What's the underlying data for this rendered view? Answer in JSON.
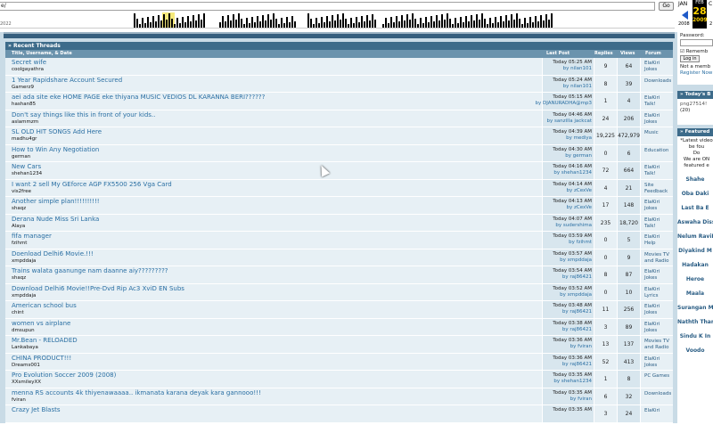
{
  "topbar": {
    "url_fragment": "e/",
    "go_label": "Go",
    "year_left": "2022"
  },
  "calendar": {
    "prev_month": "JAN",
    "month": "FEB",
    "day": "28",
    "year": "2009",
    "next_prefix": "C",
    "prev_year": "2008",
    "next_year_prefix": "2"
  },
  "threads": {
    "header": "» Recent Threads",
    "columns": {
      "title": "Title, Username, & Date",
      "last_post": "Last Post",
      "replies": "Replies",
      "views": "Views",
      "forum": "Forum"
    },
    "rows": [
      {
        "title": "Secret wife",
        "user": "coolgayathra",
        "time": "Today 05:25 AM",
        "by": "by nilan101",
        "replies": "9",
        "views": "64",
        "forum": [
          "ElaKiri",
          "Jokes"
        ]
      },
      {
        "title": "1 Year Rapidshare Account Secured",
        "user": "Gamerz9",
        "time": "Today 05:24 AM",
        "by": "by nilan101",
        "replies": "8",
        "views": "39",
        "forum": [
          "Downloads"
        ]
      },
      {
        "title": "aei ada site eke HOME PAGE eke thiyana MUSIC VEDIOS DL KARANNA BERI??????",
        "user": "hashan85",
        "time": "Today 05:15 AM",
        "by": "by DJANURADHA@mp3",
        "replies": "1",
        "views": "4",
        "forum": [
          "ElaKiri",
          "Talk!"
        ]
      },
      {
        "title": "Don't say things like this in front of your kids..",
        "user": "aslammzm",
        "time": "Today 04:46 AM",
        "by": "by sanzilla jackcat",
        "replies": "24",
        "views": "206",
        "forum": [
          "ElaKiri",
          "Jokes"
        ]
      },
      {
        "title": "SL OLD HIT SONGS Add Here",
        "user": "madhu4gr",
        "time": "Today 04:39 AM",
        "by": "by mediya",
        "replies": "19,225",
        "views": "472,979",
        "forum": [
          "Music"
        ]
      },
      {
        "title": "How to Win Any Negotiation",
        "user": "german",
        "time": "Today 04:30 AM",
        "by": "by german",
        "replies": "0",
        "views": "6",
        "forum": [
          "Education"
        ]
      },
      {
        "title": "New Cars",
        "user": "shehan1234",
        "time": "Today 04:16 AM",
        "by": "by shehan1234",
        "replies": "72",
        "views": "664",
        "forum": [
          "ElaKiri",
          "Talk!"
        ]
      },
      {
        "title": "I want 2 sell My GEforce AGP FX5500 256 Vga Card",
        "user": "vis2free",
        "time": "Today 04:14 AM",
        "by": "by zCexVe",
        "replies": "4",
        "views": "21",
        "forum": [
          "Site",
          "Feedback"
        ]
      },
      {
        "title": "Another simple plan!!!!!!!!!!",
        "user": "shaqz",
        "time": "Today 04:13 AM",
        "by": "by zCexVe",
        "replies": "17",
        "views": "148",
        "forum": [
          "ElaKiri",
          "Jokes"
        ]
      },
      {
        "title": "Derana Nude Miss Sri Lanka",
        "user": "Alaya",
        "time": "Today 04:07 AM",
        "by": "by sudershima",
        "replies": "235",
        "views": "18,720",
        "forum": [
          "ElaKiri",
          "Talk!"
        ]
      },
      {
        "title": "fifa manager",
        "user": "fzihmt",
        "time": "Today 03:59 AM",
        "by": "by fzihmt",
        "replies": "0",
        "views": "5",
        "forum": [
          "ElaKiri",
          "Help"
        ]
      },
      {
        "title": "Doenload Delhi6 Movie.!!!",
        "user": "xmpddaja",
        "time": "Today 03:57 AM",
        "by": "by xmpddaja",
        "replies": "0",
        "views": "9",
        "forum": [
          "Movies TV",
          "and Radio"
        ]
      },
      {
        "title": "Trains walata gaanunge nam daanne aiy?????????",
        "user": "shaqz",
        "time": "Today 03:54 AM",
        "by": "by raj86421",
        "replies": "8",
        "views": "87",
        "forum": [
          "ElaKiri",
          "Jokes"
        ]
      },
      {
        "title": "Download Delhi6 Movie!!Pre-Dvd Rip Ac3 XviD EN Subs",
        "user": "xmpddaja",
        "time": "Today 03:52 AM",
        "by": "by xmpddaja",
        "replies": "0",
        "views": "10",
        "forum": [
          "ElaKiri",
          "Lyrics"
        ]
      },
      {
        "title": "American school bus",
        "user": "chint",
        "time": "Today 03:48 AM",
        "by": "by raj86421",
        "replies": "11",
        "views": "256",
        "forum": [
          "ElaKiri",
          "Jokes"
        ]
      },
      {
        "title": "women vs airplane",
        "user": "dmsupun",
        "time": "Today 03:38 AM",
        "by": "by raj86421",
        "replies": "3",
        "views": "89",
        "forum": [
          "ElaKiri",
          "Jokes"
        ]
      },
      {
        "title": "Mr.Bean - RELOADED",
        "user": "Lankabaya",
        "time": "Today 03:36 AM",
        "by": "by fviran",
        "replies": "13",
        "views": "137",
        "forum": [
          "Movies TV",
          "and Radio"
        ]
      },
      {
        "title": "CHINA PRODUCT!!!",
        "user": "Dreams001",
        "time": "Today 03:36 AM",
        "by": "by raj86421",
        "replies": "52",
        "views": "413",
        "forum": [
          "ElaKiri",
          "Jokes"
        ]
      },
      {
        "title": "Pro Evolution Soccer 2009 (2008)",
        "user": "XXsmileyXX",
        "time": "Today 03:35 AM",
        "by": "by shehan1234",
        "replies": "1",
        "views": "8",
        "forum": [
          "PC Games"
        ]
      },
      {
        "title": "menna RS accounts 4k thiyenawaaaa.. ikmanata karana deyak kara gannooo!!!",
        "user": "fviran",
        "time": "Today 03:35 AM",
        "by": "by fviran",
        "replies": "6",
        "views": "32",
        "forum": [
          "Downloads"
        ]
      },
      {
        "title": "Crazy Jet Blasts",
        "user": "",
        "time": "Today 03:35 AM",
        "by": "",
        "replies": "3",
        "views": "24",
        "forum": [
          "ElaKiri"
        ]
      }
    ]
  },
  "sidebar": {
    "password_label": "Password:",
    "remember_label": "Rememb",
    "login_btn": "Log in",
    "not_member": "Not a memb",
    "register": "Register Now",
    "todays_hdr": "» Today's B",
    "todays_item": "png27514!",
    "todays_count": "(20)",
    "featured_hdr": "» Featured",
    "featured_lines": [
      "*Latest video",
      "be fou",
      "Do",
      "We are ON",
      "featured e"
    ],
    "featured_links": [
      "Shahe",
      "Oba Daki",
      "Last Ba E",
      "Aswaha Dissa",
      "Nelum RaviHans",
      "Diyakind M",
      "Hadakan",
      "Heroe",
      "Maala",
      "Surangan M",
      "Nathth Thaniwe",
      "Sindu K In",
      "Voodo"
    ]
  },
  "colors": {
    "header_bg": "#3d6b8a",
    "page_bg": "#c9dbe6",
    "row_bg": "#e7f0f5",
    "link": "#2a6fa3"
  }
}
